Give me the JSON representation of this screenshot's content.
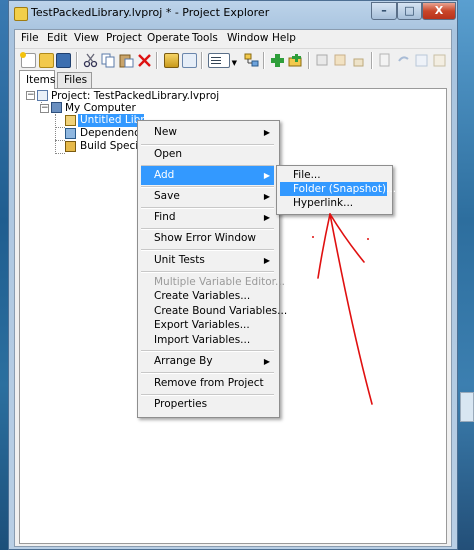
{
  "window": {
    "title": "TestPackedLibrary.lvproj * - Project Explorer",
    "controls": {
      "minimize": "–",
      "maximize": "□",
      "close": "X"
    }
  },
  "menubar": [
    "File",
    "Edit",
    "View",
    "Project",
    "Operate",
    "Tools",
    "Window",
    "Help"
  ],
  "toolbar": {
    "buttons": [
      "new-icon",
      "open-icon",
      "save-all-icon",
      "cut-icon",
      "copy-icon",
      "paste-icon",
      "delete-icon",
      "build-icon",
      "filter-icon",
      "view-options-icon",
      "dependencies-icon",
      "add-item-icon",
      "add-folder-icon",
      "collapse-icon",
      "expand-icon",
      "help-icon"
    ]
  },
  "tabs": [
    "Items",
    "Files"
  ],
  "tree": {
    "project": "Project: TestPackedLibrary.lvproj",
    "computer": "My Computer",
    "library": "Untitled Library 1",
    "library_visible": "Untitled Librar",
    "dependencies": "Dependencies",
    "build": "Build Specifications"
  },
  "context_menu": {
    "items": [
      "New",
      "Open",
      "Add",
      "Save",
      "Find",
      "Show Error Window",
      "Unit Tests",
      "Multiple Variable Editor...",
      "Create Variables...",
      "Create Bound Variables...",
      "Export Variables...",
      "Import Variables...",
      "Arrange By",
      "Remove from Project",
      "Properties"
    ],
    "highlighted": "Add"
  },
  "submenu": {
    "items": [
      "File...",
      "Folder (Snapshot)...",
      "Hyperlink..."
    ],
    "highlighted": "Folder (Snapshot)..."
  },
  "colors": {
    "highlight": "#3399ff",
    "annotation": "#e01010"
  }
}
